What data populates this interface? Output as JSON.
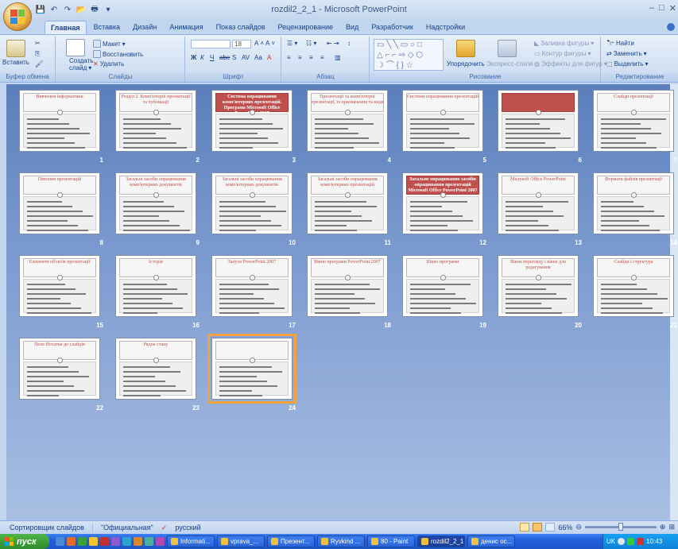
{
  "window": {
    "title": "rozdil2_2_1 - Microsoft PowerPoint",
    "controls": [
      "–",
      "□",
      "✕"
    ]
  },
  "tabs": [
    "Главная",
    "Вставка",
    "Дизайн",
    "Анимация",
    "Показ слайдов",
    "Рецензирование",
    "Вид",
    "Разработчик",
    "Надстройки"
  ],
  "ribbon": {
    "clipboard": {
      "label": "Буфер обмена",
      "paste": "Вставить"
    },
    "slides": {
      "label": "Слайды",
      "create": "Создать",
      "create2": "слайд",
      "layout": "Макет",
      "reset": "Восстановить",
      "delete": "Удалить"
    },
    "font": {
      "label": "Шрифт",
      "size": "18",
      "bold": "Ж",
      "italic": "К",
      "underline": "Ч",
      "strike": "abe",
      "shadow": "S",
      "spacing": "AV",
      "case": "Aa",
      "grow": "A",
      "shrink": "A"
    },
    "paragraph": {
      "label": "Абзац"
    },
    "drawing": {
      "label": "Рисование",
      "arrange": "Упорядочить",
      "quick_styles": "Экспресс-стили",
      "fill": "Заливка фигуры",
      "outline": "Контур фигуры",
      "effects": "Эффекты для фигур"
    },
    "editing": {
      "label": "Редактирование",
      "find": "Найти",
      "replace": "Заменить",
      "select": "Выделить"
    }
  },
  "slides": [
    {
      "n": "1",
      "title": "Вивчення інформатики",
      "red": false
    },
    {
      "n": "2",
      "title": "Розділ 2. Комп'ютерні презентації та публікації",
      "red": false
    },
    {
      "n": "3",
      "title": "Система опрацювання комп'ютерних презентацій. Програма Microsoft Office PowerPoint 2007",
      "red": true
    },
    {
      "n": "4",
      "title": "Презентації та комп'ютерні презентації, їх призначення та види",
      "red": false
    },
    {
      "n": "5",
      "title": "Системи опрацювання презентацій",
      "red": false
    },
    {
      "n": "6",
      "title": "",
      "red": true
    },
    {
      "n": "7",
      "title": "Слайди презентації",
      "red": false
    },
    {
      "n": "8",
      "title": "Питання презентацій",
      "red": false
    },
    {
      "n": "9",
      "title": "Загальні засоби опрацювання комп'ютерних документів",
      "red": false
    },
    {
      "n": "10",
      "title": "Загальні засоби опрацювання комп'ютерних документів",
      "red": false
    },
    {
      "n": "11",
      "title": "Загальні засоби опрацювання комп'ютерних презентацій",
      "red": false
    },
    {
      "n": "12",
      "title": "Загальне опрацювання засобів опрацювання презентацій Microsoft Office PowerPoint 2007",
      "red": true
    },
    {
      "n": "13",
      "title": "Microsoft Office PowerPoint",
      "red": false
    },
    {
      "n": "14",
      "title": "Формати файлів презентації",
      "red": false
    },
    {
      "n": "15",
      "title": "Елементи об'єктів презентації",
      "red": false
    },
    {
      "n": "16",
      "title": "Історія",
      "red": false
    },
    {
      "n": "17",
      "title": "Запуск PowerPoint 2007",
      "red": false
    },
    {
      "n": "18",
      "title": "Вікно програми PowerPoint 2007",
      "red": false
    },
    {
      "n": "19",
      "title": "Вікно програми",
      "red": false
    },
    {
      "n": "20",
      "title": "Вікна перегляду і вікна для редагування",
      "red": false
    },
    {
      "n": "21",
      "title": "Слайди і структура",
      "red": false
    },
    {
      "n": "22",
      "title": "Поле Нотатки до слайдів",
      "red": false
    },
    {
      "n": "23",
      "title": "Рядок стану",
      "red": false
    },
    {
      "n": "24",
      "title": "",
      "red": false
    }
  ],
  "status": {
    "view": "Сортировщик слайдов",
    "theme": "\"Официальная\"",
    "lang": "русский",
    "zoom": "66%"
  },
  "taskbar": {
    "start": "пуск",
    "tasks": [
      "Informati...",
      "vprava_...",
      "Презент...",
      "Ryvkind ...",
      "80 - Paint",
      "rozdil2_2_1",
      "денис ос..."
    ],
    "lang": "UK",
    "clock": "10:43"
  }
}
